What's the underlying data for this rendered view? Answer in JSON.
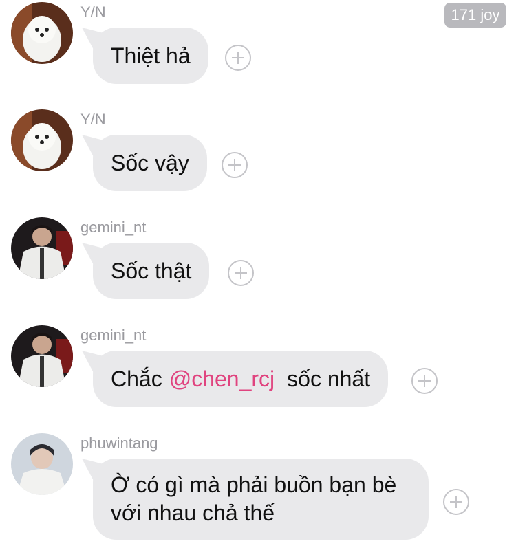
{
  "header": {
    "badge": "171 joy"
  },
  "messages": [
    {
      "user": "Y/N",
      "avatar_icon": "white-dog-avatar-icon",
      "text": "Thiệt hả"
    },
    {
      "user": "Y/N",
      "avatar_icon": "white-dog-avatar-icon",
      "text": "Sốc vậy"
    },
    {
      "user": "gemini_nt",
      "avatar_icon": "man-in-shirt-avatar-icon",
      "text": "Sốc thật"
    },
    {
      "user": "gemini_nt",
      "avatar_icon": "man-in-shirt-avatar-icon",
      "text_before": "Chắc",
      "mention": "@chen_rcj",
      "text_after": "sốc nhất"
    },
    {
      "user": "phuwintang",
      "avatar_icon": "man-portrait-avatar-icon",
      "text": "Ờ có gì mà phải buồn bạn bè với nhau chả thế"
    }
  ],
  "colors": {
    "bubble": "#e9e9eb",
    "mention": "#e0447f",
    "username": "#9a9a9f"
  }
}
